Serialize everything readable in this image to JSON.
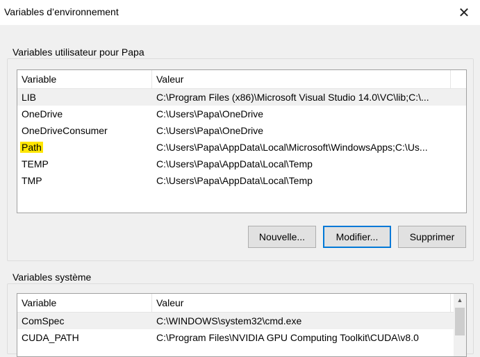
{
  "window": {
    "title": "Variables d’environnement",
    "close_glyph": "✕"
  },
  "user_vars": {
    "group_label": "Variables utilisateur pour Papa",
    "columns": [
      "Variable",
      "Valeur"
    ],
    "rows": [
      {
        "variable": "LIB",
        "value": "C:\\Program Files (x86)\\Microsoft Visual Studio 14.0\\VC\\lib;C:\\..."
      },
      {
        "variable": "OneDrive",
        "value": "C:\\Users\\Papa\\OneDrive"
      },
      {
        "variable": "OneDriveConsumer",
        "value": "C:\\Users\\Papa\\OneDrive"
      },
      {
        "variable": "Path",
        "value": "C:\\Users\\Papa\\AppData\\Local\\Microsoft\\WindowsApps;C:\\Us..."
      },
      {
        "variable": "TEMP",
        "value": "C:\\Users\\Papa\\AppData\\Local\\Temp"
      },
      {
        "variable": "TMP",
        "value": "C:\\Users\\Papa\\AppData\\Local\\Temp"
      }
    ],
    "buttons": {
      "new": "Nouvelle...",
      "edit": "Modifier...",
      "delete": "Supprimer"
    }
  },
  "system_vars": {
    "group_label": "Variables système",
    "columns": [
      "Variable",
      "Valeur"
    ],
    "rows": [
      {
        "variable": "ComSpec",
        "value": "C:\\WINDOWS\\system32\\cmd.exe"
      },
      {
        "variable": "CUDA_PATH",
        "value": "C:\\Program Files\\NVIDIA GPU Computing Toolkit\\CUDA\\v8.0"
      }
    ]
  },
  "colors": {
    "highlight": "#ffe600",
    "accent": "#0078d7"
  }
}
